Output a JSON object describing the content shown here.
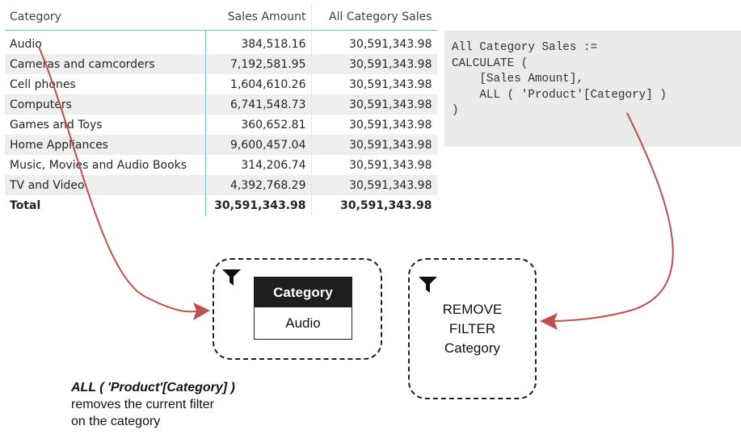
{
  "table": {
    "headers": {
      "category": "Category",
      "sales_amount": "Sales Amount",
      "all_category_sales": "All Category Sales"
    },
    "rows": [
      {
        "category": "Audio",
        "sales_amount": "384,518.16",
        "all_category_sales": "30,591,343.98"
      },
      {
        "category": "Cameras and camcorders",
        "sales_amount": "7,192,581.95",
        "all_category_sales": "30,591,343.98"
      },
      {
        "category": "Cell phones",
        "sales_amount": "1,604,610.26",
        "all_category_sales": "30,591,343.98"
      },
      {
        "category": "Computers",
        "sales_amount": "6,741,548.73",
        "all_category_sales": "30,591,343.98"
      },
      {
        "category": "Games and Toys",
        "sales_amount": "360,652.81",
        "all_category_sales": "30,591,343.98"
      },
      {
        "category": "Home Appliances",
        "sales_amount": "9,600,457.04",
        "all_category_sales": "30,591,343.98"
      },
      {
        "category": "Music, Movies and Audio Books",
        "sales_amount": "314,206.74",
        "all_category_sales": "30,591,343.98"
      },
      {
        "category": "TV and Video",
        "sales_amount": "4,392,768.29",
        "all_category_sales": "30,591,343.98"
      }
    ],
    "total": {
      "category": "Total",
      "sales_amount": "30,591,343.98",
      "all_category_sales": "30,591,343.98"
    }
  },
  "code": {
    "lines": [
      "All Category Sales :=",
      "CALCULATE (",
      "    [Sales Amount],",
      "    ALL ( 'Product'[Category] )",
      ")"
    ]
  },
  "filter_left": {
    "header": "Category",
    "value": "Audio"
  },
  "filter_right": {
    "lines": [
      "REMOVE",
      "FILTER",
      "Category"
    ]
  },
  "caption": {
    "code": "ALL ( 'Product'[Category] )",
    "line1": "removes the current filter",
    "line2": "on the category"
  },
  "colors": {
    "arrow": "#c0504d",
    "grid_accent": "#6ec3cf",
    "code_background": "#ebebeb",
    "filter_header": "#1e1e1e"
  },
  "icons": [
    "funnel-icon",
    "funnel-icon"
  ]
}
